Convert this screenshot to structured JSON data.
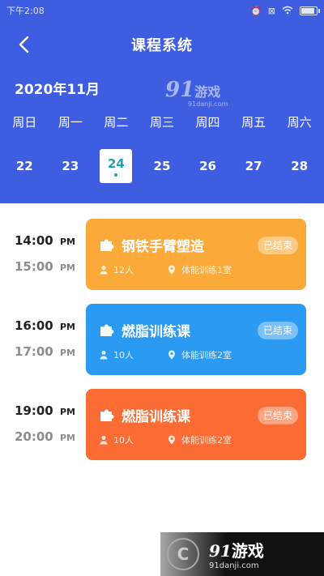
{
  "status_bar": {
    "time": "下午2:08"
  },
  "header": {
    "title": "课程系统",
    "month": "2020年11月"
  },
  "watermark_top": {
    "brand_num": "91",
    "brand_name": "游戏",
    "domain": "91danji.com"
  },
  "week": {
    "days": [
      "周日",
      "周一",
      "周二",
      "周三",
      "周四",
      "周五",
      "周六"
    ],
    "dates": [
      "22",
      "23",
      "24",
      "25",
      "26",
      "27",
      "28"
    ],
    "selected_index": 2
  },
  "colors": {
    "header_bg": "#3f5de0",
    "selected_date_text": "#1fa3ad",
    "card_orange": "#fbaa3a",
    "card_blue": "#2b9af3",
    "card_red_orange": "#fb6c34"
  },
  "sessions": [
    {
      "start_time": "14:00",
      "start_ampm": "PM",
      "end_time": "15:00",
      "end_ampm": "PM",
      "title": "钢铁手臂塑造",
      "status": "已结束",
      "people": "12人",
      "location": "体能训练1室",
      "color": "#fbaa3a"
    },
    {
      "start_time": "16:00",
      "start_ampm": "PM",
      "end_time": "17:00",
      "end_ampm": "PM",
      "title": "燃脂训练课",
      "status": "已结束",
      "people": "10人",
      "location": "体能训练2室",
      "color": "#2b9af3"
    },
    {
      "start_time": "19:00",
      "start_ampm": "PM",
      "end_time": "20:00",
      "end_ampm": "PM",
      "title": "燃脂训练课",
      "status": "已结束",
      "people": "10人",
      "location": "体能训练2室",
      "color": "#fb6c34"
    }
  ],
  "watermark_bottom": {
    "brand_num": "91",
    "brand_name": "游戏",
    "domain": "91danji.com"
  }
}
